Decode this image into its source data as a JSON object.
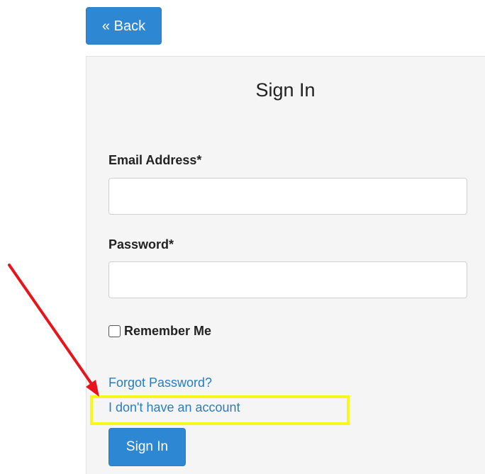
{
  "back_button": {
    "label": "« Back"
  },
  "form": {
    "title": "Sign In",
    "email_label": "Email Address*",
    "email_value": "",
    "password_label": "Password*",
    "password_value": "",
    "remember_label": "Remember Me",
    "remember_checked": false,
    "forgot_link": "Forgot Password?",
    "no_account_link": "I don't have an account",
    "submit_label": "Sign In"
  },
  "annotations": {
    "arrow_color": "#e8141b",
    "highlight_color": "#f7f71a"
  },
  "colors": {
    "primary": "#2d87d3",
    "link": "#2a7cc2",
    "panel_bg": "#f5f5f5"
  }
}
